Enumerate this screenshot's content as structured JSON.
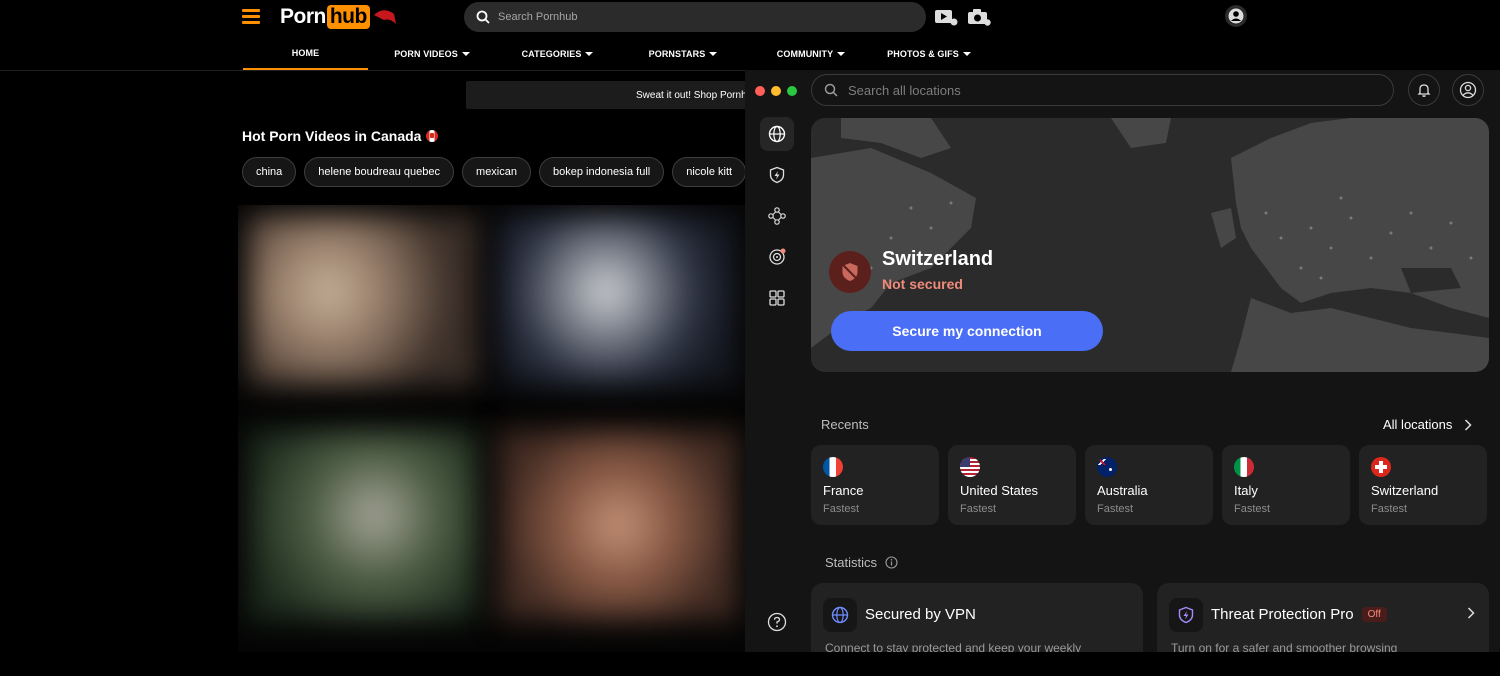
{
  "site": {
    "logo_part1": "Porn",
    "logo_part2": "hub",
    "search_placeholder": "Search Pornhub",
    "nav": [
      {
        "label": "HOME"
      },
      {
        "label": "PORN VIDEOS"
      },
      {
        "label": "CATEGORIES"
      },
      {
        "label": "PORNSTARS"
      },
      {
        "label": "COMMUNITY"
      },
      {
        "label": "PHOTOS & GIFS"
      }
    ],
    "promo_text": "Sweat it out! Shop Pornh",
    "section_title": "Hot Porn Videos in Canada",
    "chips": [
      "china",
      "helene boudreau quebec",
      "mexican",
      "bokep indonesia full",
      "nicole kitt"
    ],
    "accent_color": "#ff9000"
  },
  "vpn": {
    "search_placeholder": "Search all locations",
    "sidebar_icons": [
      "globe-icon",
      "shield-bolt-icon",
      "mesh-network-icon",
      "target-icon",
      "apps-grid-icon",
      "help-icon"
    ],
    "location": {
      "country": "Switzerland",
      "status": "Not secured",
      "button": "Secure my connection"
    },
    "recents": {
      "title": "Recents",
      "all_locations": "All locations",
      "items": [
        {
          "name": "France",
          "sub": "Fastest"
        },
        {
          "name": "United States",
          "sub": "Fastest"
        },
        {
          "name": "Australia",
          "sub": "Fastest"
        },
        {
          "name": "Italy",
          "sub": "Fastest"
        },
        {
          "name": "Switzerland",
          "sub": "Fastest"
        }
      ]
    },
    "statistics": {
      "title": "Statistics",
      "vpn_card": {
        "title": "Secured by VPN",
        "desc": "Connect to stay protected and keep your weekly"
      },
      "threat_card": {
        "title": "Threat Protection Pro",
        "badge": "Off",
        "desc": "Turn on for a safer and smoother browsing"
      }
    },
    "accent_color": "#4a6ef5",
    "danger_color": "#f08a7a"
  }
}
